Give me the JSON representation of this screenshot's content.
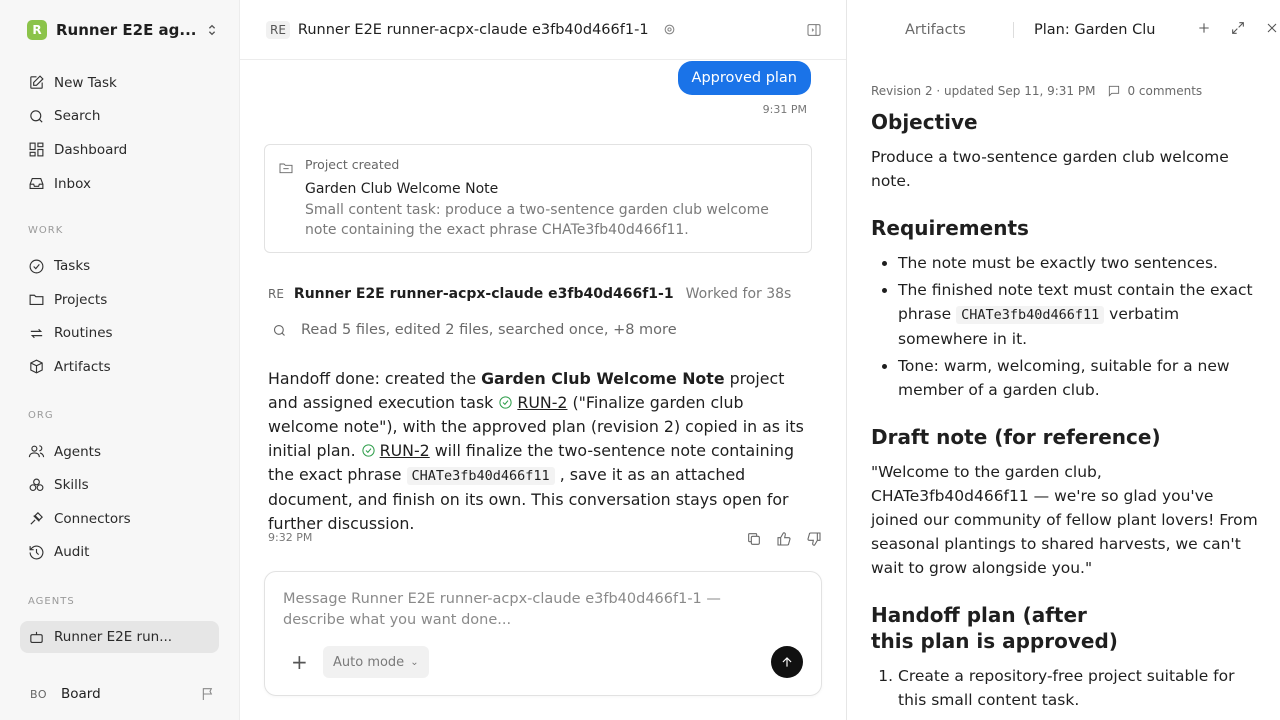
{
  "workspace": {
    "name": "Runner E2E ag...",
    "logo_letter": "R",
    "logo_color": "#8bc34a"
  },
  "nav_main": [
    {
      "label": "New Task",
      "icon": "edit-icon"
    },
    {
      "label": "Search",
      "icon": "search-icon"
    },
    {
      "label": "Dashboard",
      "icon": "dashboard-icon"
    },
    {
      "label": "Inbox",
      "icon": "inbox-icon"
    }
  ],
  "section_work": "WORK",
  "nav_work": [
    {
      "label": "Tasks",
      "icon": "check-circle-icon"
    },
    {
      "label": "Projects",
      "icon": "folder-icon"
    },
    {
      "label": "Routines",
      "icon": "repeat-icon"
    },
    {
      "label": "Artifacts",
      "icon": "cube-icon"
    }
  ],
  "section_org": "ORG",
  "nav_org": [
    {
      "label": "Agents",
      "icon": "users-icon"
    },
    {
      "label": "Skills",
      "icon": "skills-icon"
    },
    {
      "label": "Connectors",
      "icon": "plug-icon"
    },
    {
      "label": "Audit",
      "icon": "history-icon"
    }
  ],
  "section_agents": "AGENTS",
  "agents_list": [
    {
      "label": "Runner E2E run...",
      "icon": "bot-icon"
    }
  ],
  "board": {
    "initials": "BO",
    "label": "Board"
  },
  "chat": {
    "header_chip": "RE",
    "title": "Runner E2E runner-acpx-claude e3fb40d466f1-1",
    "user_bubble": "Approved plan",
    "user_time": "9:31 PM",
    "project_card": {
      "label": "Project created",
      "title": "Garden Club Welcome Note",
      "description": "Small content task: produce a two-sentence garden club welcome note containing the exact phrase CHATe3fb40d466f11."
    },
    "agent_chip": "RE",
    "agent_name": "Runner E2E runner-acpx-claude e3fb40d466f1-1",
    "worked": "Worked for 38s",
    "activity_summary": "Read 5 files, edited 2 files, searched once, +8 more",
    "response": {
      "p1": "Handoff done: created the ",
      "project_bold": "Garden Club Welcome Note",
      "p2": " project and assigned execution task ",
      "run_link": "RUN-2",
      "p3": " (\"Finalize garden club welcome note\"), with the approved plan (revision 2) copied in as its initial plan. ",
      "run_link2": "RUN-2",
      "p4": " will finalize the two-sentence note containing the exact phrase ",
      "phrase": "CHATe3fb40d466f11",
      "p5": " , save it as an attached document, and finish on its own. This conversation stays open for further discussion."
    },
    "response_time": "9:32 PM",
    "composer_placeholder": "Message Runner E2E runner-acpx-claude e3fb40d466f1-1 — describe what you want done...",
    "mode_label": "Auto mode"
  },
  "panel": {
    "tab_artifacts": "Artifacts",
    "tab_plan": "Plan: Garden Clu",
    "meta": "Revision 2 · updated Sep 11, 9:31 PM",
    "comments": "0 comments",
    "h_objective": "Objective",
    "objective": "Produce a two-sentence garden club welcome note.",
    "h_requirements": "Requirements",
    "req1": "The note must be exactly two sentences.",
    "req2a": "The finished note text must contain the exact phrase ",
    "req2code": "CHATe3fb40d466f11",
    "req2b": " verbatim somewhere in it.",
    "req3": "Tone: warm, welcoming, suitable for a new member of a garden club.",
    "h_draft": "Draft note (for reference)",
    "draft": "\"Welcome to the garden club, CHATe3fb40d466f11 — we're so glad you've joined our community of fellow plant lovers! From seasonal plantings to shared harvests, we can't wait to grow alongside you.\"",
    "h_handoff": "Handoff plan (after this plan is approved)",
    "handoff1": "Create a repository-free project suitable for this small content task."
  },
  "colors": {
    "accent": "#1a73e8",
    "success": "#2e9d4a"
  }
}
